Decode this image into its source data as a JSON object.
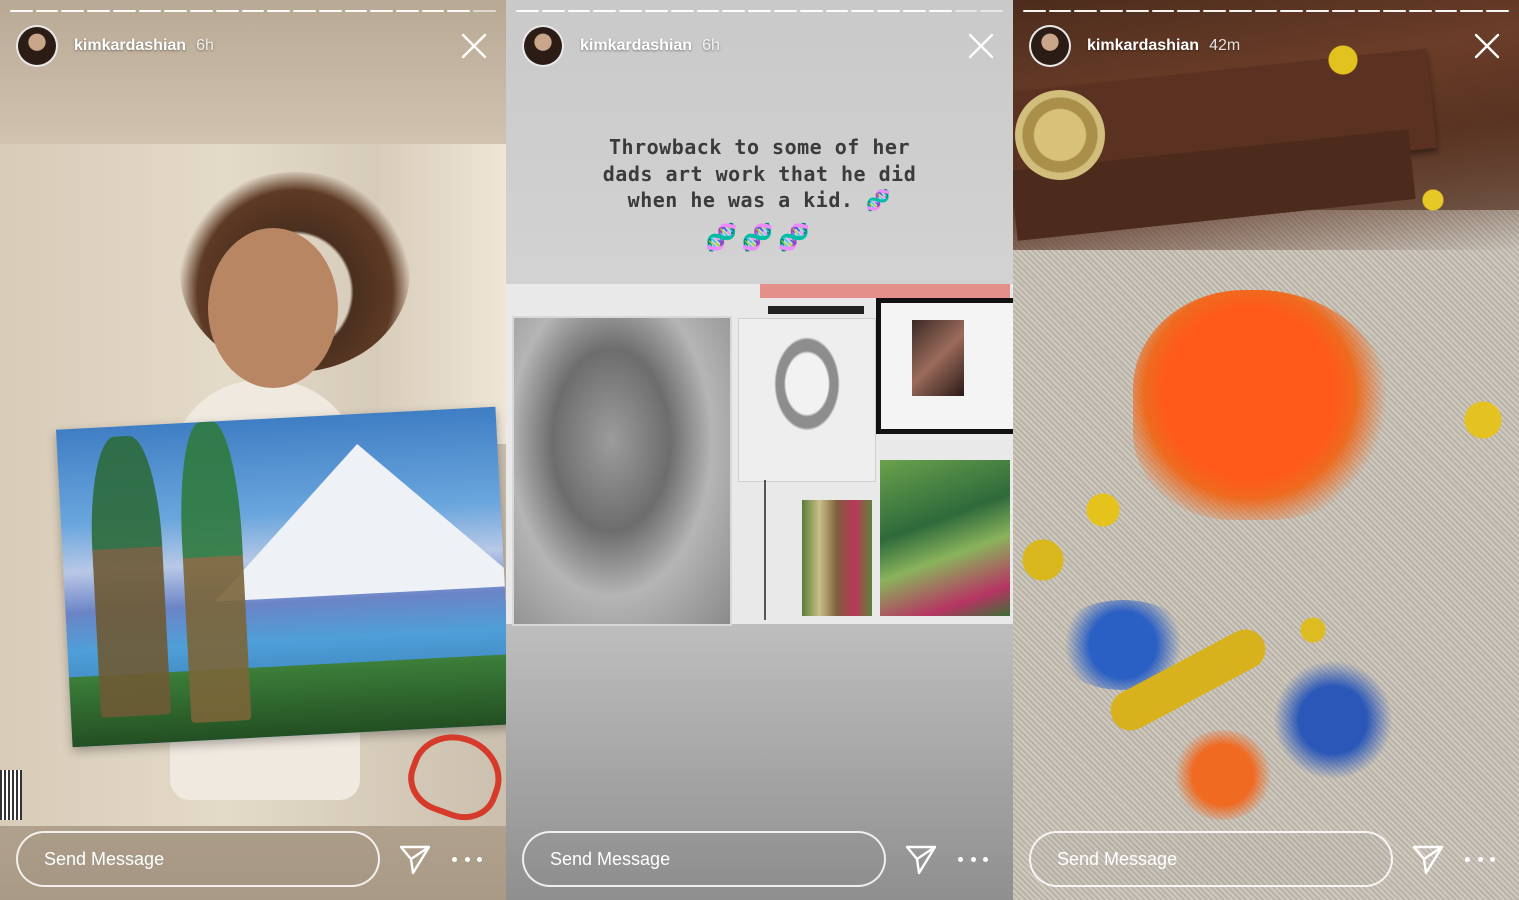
{
  "stories": [
    {
      "username": "kimkardashian",
      "time": "6h",
      "progress": {
        "segments": 19,
        "completed": 18
      },
      "message_placeholder": "Send Message"
    },
    {
      "username": "kimkardashian",
      "time": "6h",
      "progress": {
        "segments": 19,
        "completed": 17
      },
      "caption_lines": [
        "Throwback to some of her",
        "dads art work that he did",
        "when he was a kid. 🧬"
      ],
      "caption_emoji": "🧬🧬🧬",
      "message_placeholder": "Send Message"
    },
    {
      "username": "kimkardashian",
      "time": "42m",
      "progress": {
        "segments": 19,
        "completed": 19
      },
      "message_placeholder": "Send Message"
    }
  ],
  "icons": {
    "close": "close-icon",
    "send": "paper-plane-icon",
    "more": "more-dots-icon"
  },
  "colors": {
    "overlay_text": "#ffffff",
    "caption_text": "#3b3b3b"
  }
}
